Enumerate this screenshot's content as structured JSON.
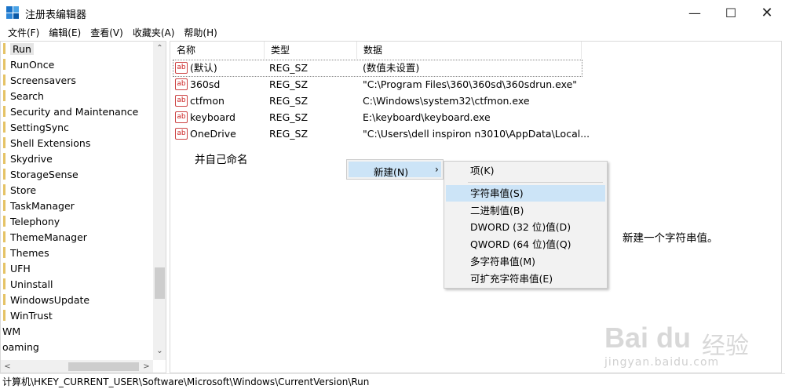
{
  "window": {
    "title": "注册表编辑器",
    "minimize": "—",
    "maximize": "☐",
    "close": "✕"
  },
  "menu": [
    "文件(F)",
    "编辑(E)",
    "查看(V)",
    "收藏夹(A)",
    "帮助(H)"
  ],
  "tree": {
    "items": [
      {
        "label": "Run",
        "selected": true
      },
      {
        "label": "RunOnce"
      },
      {
        "label": "Screensavers"
      },
      {
        "label": "Search"
      },
      {
        "label": "Security and Maintenance"
      },
      {
        "label": "SettingSync"
      },
      {
        "label": "Shell Extensions"
      },
      {
        "label": "Skydrive"
      },
      {
        "label": "StorageSense"
      },
      {
        "label": "Store"
      },
      {
        "label": "TaskManager"
      },
      {
        "label": "Telephony"
      },
      {
        "label": "ThemeManager"
      },
      {
        "label": "Themes"
      },
      {
        "label": "UFH"
      },
      {
        "label": "Uninstall"
      },
      {
        "label": "WindowsUpdate"
      },
      {
        "label": "WinTrust"
      },
      {
        "label": "WM"
      },
      {
        "label": "oaming"
      }
    ],
    "scroll_up": "⌃",
    "scroll_down": "⌄",
    "scroll_left": "<",
    "scroll_right": ">"
  },
  "values": {
    "columns": {
      "name": "名称",
      "type": "类型",
      "data": "数据"
    },
    "rows": [
      {
        "name": "(默认)",
        "type": "REG_SZ",
        "data": "(数值未设置)"
      },
      {
        "name": "360sd",
        "type": "REG_SZ",
        "data": "\"C:\\Program Files\\360\\360sd\\360sdrun.exe\""
      },
      {
        "name": "ctfmon",
        "type": "REG_SZ",
        "data": "C:\\Windows\\system32\\ctfmon.exe"
      },
      {
        "name": "keyboard",
        "type": "REG_SZ",
        "data": "E:\\keyboard\\keyboard.exe"
      },
      {
        "name": "OneDrive",
        "type": "REG_SZ",
        "data": "\"C:\\Users\\dell inspiron n3010\\AppData\\Local..."
      }
    ],
    "icon_text": "ab"
  },
  "annotations": {
    "left": "并自己命名",
    "right": "新建一个字符串值。"
  },
  "context_menu": {
    "new_label": "新建(N)",
    "arrow": "›"
  },
  "submenu": {
    "items": [
      "项(K)",
      "字符串值(S)",
      "二进制值(B)",
      "DWORD (32 位)值(D)",
      "QWORD (64 位)值(Q)",
      "多字符串值(M)",
      "可扩充字符串值(E)"
    ],
    "highlighted_index": 1
  },
  "statusbar": {
    "path": "计算机\\HKEY_CURRENT_USER\\Software\\Microsoft\\Windows\\CurrentVersion\\Run"
  },
  "watermark": {
    "logo": "Bai du",
    "cn": "经验",
    "url": "jingyan.baidu.com"
  }
}
